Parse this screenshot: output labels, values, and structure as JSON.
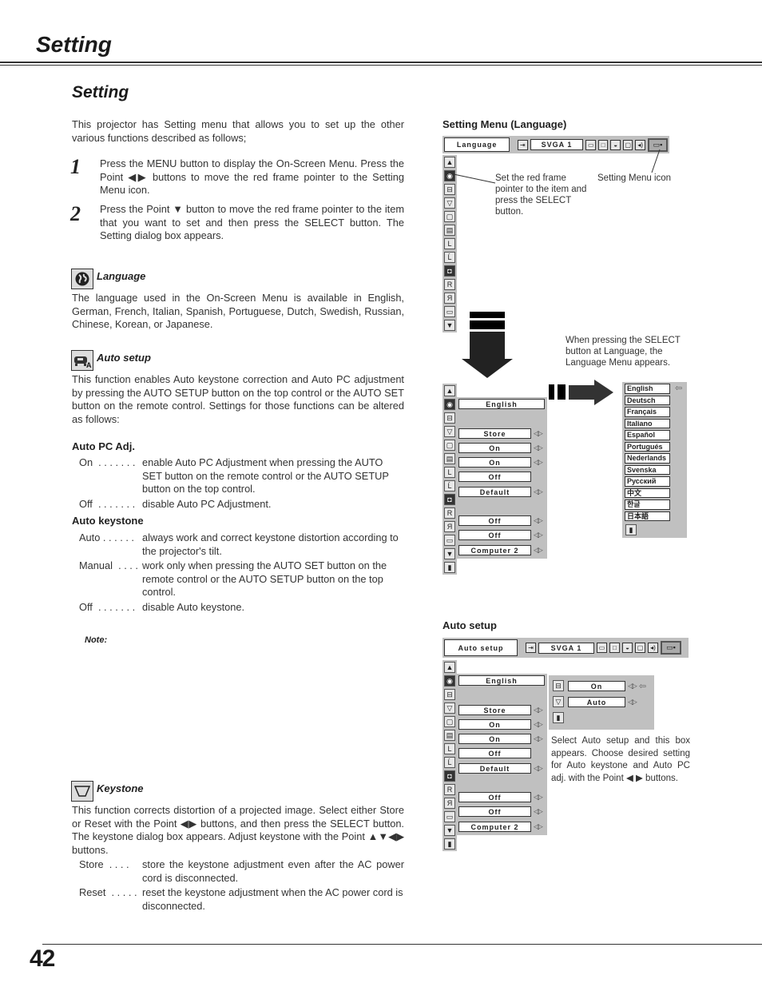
{
  "header": {
    "title": "Setting"
  },
  "section": {
    "title": "Setting",
    "intro": "This projector has Setting menu that allows you to set up the other various functions described as follows;",
    "steps": [
      {
        "num": "1",
        "text": "Press the MENU button to display the On-Screen Menu. Press the Point ◀▶ buttons to move the red frame pointer to the Setting Menu icon."
      },
      {
        "num": "2",
        "text": "Press the Point ▼ button to move the red frame pointer to the item that you want to set and then press the SELECT button.  The Setting dialog box appears."
      }
    ]
  },
  "language": {
    "icon": "globe-icon",
    "title": "Language",
    "text": "The language used in the On-Screen Menu is available in English, German, French, Italian, Spanish, Portuguese, Dutch, Swedish, Russian, Chinese, Korean, or Japanese."
  },
  "auto_setup": {
    "icon": "auto-setup-icon",
    "title": "Auto setup",
    "text": "This function enables Auto keystone correction and Auto PC adjustment by pressing the AUTO SETUP button on the top control or the AUTO SET button on the remote control.  Settings for those functions can be altered as follows:",
    "auto_pc_adj": {
      "title": "Auto PC Adj.",
      "items": [
        {
          "term": "On  . . . . . . .",
          "desc": "enable Auto PC Adjustment when pressing the AUTO SET button on the remote control or the AUTO SETUP button on the top control."
        },
        {
          "term": "Off  . . . . . . .",
          "desc": "disable Auto PC Adjustment."
        }
      ]
    },
    "auto_keystone": {
      "title": "Auto keystone",
      "items": [
        {
          "term": "Auto . . . . . .",
          "desc": "always work and correct keystone distortion according to the projector's tilt."
        },
        {
          "term": "Manual  . . . .",
          "desc": "work only when pressing the AUTO SET button on the remote control or the AUTO SETUP button on the top control."
        },
        {
          "term": "Off  . . . . . . .",
          "desc": "disable Auto keystone."
        }
      ]
    },
    "note": "Note:"
  },
  "keystone": {
    "icon": "keystone-icon",
    "title": "Keystone",
    "text": "This function corrects distortion of a projected image.  Select either Store or Reset with the Point ◀▶ buttons, and then press the SELECT button.  The keystone dialog box appears.  Adjust keystone with the Point ▲▼◀▶ buttons.",
    "items": [
      {
        "term": "Store  . . . .",
        "desc": "store the keystone adjustment even after the AC power cord is disconnected."
      },
      {
        "term": "Reset  . . . . .",
        "desc": "reset the keystone adjustment when the AC power cord is disconnected."
      }
    ]
  },
  "figure1": {
    "label": "Setting Menu (Language)",
    "menu_name": "Language",
    "input": "SVGA 1",
    "callout_left": "Set the red frame pointer to the item and press the SELECT button.",
    "callout_right": "Setting Menu icon",
    "callout_lang": "When pressing the SELECT button at Language, the Language Menu appears.",
    "rows": [
      {
        "value": "English",
        "arrows": false
      },
      {
        "value": "Store",
        "arrows": true
      },
      {
        "value": "On",
        "arrows": true
      },
      {
        "value": "On",
        "arrows": true
      },
      {
        "value": "Off",
        "arrows": false
      },
      {
        "value": "Default",
        "arrows": true
      },
      {
        "value": "Off",
        "arrows": true
      },
      {
        "value": "Off",
        "arrows": true
      },
      {
        "value": "Computer 2",
        "arrows": true
      }
    ],
    "languages": [
      "English",
      "Deutsch",
      "Français",
      "Italiano",
      "Español",
      "Portugués",
      "Nederlands",
      "Svenska",
      "Русский",
      "中文",
      "한글",
      "日本語"
    ]
  },
  "figure2": {
    "label": "Auto setup",
    "menu_name": "Auto setup",
    "input": "SVGA 1",
    "sub_rows": [
      {
        "value": "On"
      },
      {
        "value": "Auto"
      }
    ],
    "caption": "Select Auto setup and this box appears.  Choose desired setting for Auto keystone and Auto PC adj. with the Point ◀ ▶ buttons."
  },
  "footer": {
    "page_number": "42"
  }
}
